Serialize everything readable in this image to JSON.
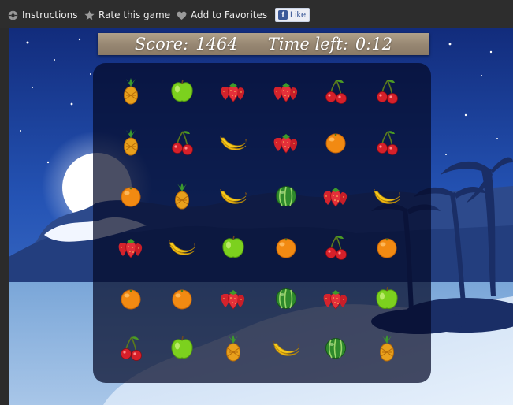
{
  "toolbar": {
    "instructions_label": "Instructions",
    "instructions_icon": "help-circle-icon",
    "rate_label": "Rate this game",
    "rate_icon": "star-icon",
    "favorites_label": "Add to Favorites",
    "favorites_icon": "heart-icon",
    "fb_like_label": "Like",
    "fb_icon": "facebook-icon"
  },
  "game": {
    "score_label": "Score:",
    "score_value": "1464",
    "time_label": "Time left:",
    "time_value": "0:12",
    "board": [
      [
        "pineapple",
        "apple",
        "strawberry",
        "strawberry",
        "cherry",
        "cherry"
      ],
      [
        "pineapple",
        "cherry",
        "banana",
        "strawberry",
        "orange",
        "cherry"
      ],
      [
        "orange",
        "pineapple",
        "banana",
        "watermelon",
        "strawberry",
        "banana"
      ],
      [
        "strawberry",
        "banana",
        "apple",
        "orange",
        "cherry",
        "orange"
      ],
      [
        "orange",
        "orange",
        "strawberry",
        "watermelon",
        "strawberry",
        "apple"
      ],
      [
        "cherry",
        "apple",
        "pineapple",
        "banana",
        "watermelon",
        "pineapple"
      ]
    ]
  },
  "colors": {
    "toolbar_bg": "#2d2d2d",
    "fb_blue": "#3b5998",
    "sky": "#1c3f9c",
    "scoreboard_wood": "#988873"
  }
}
